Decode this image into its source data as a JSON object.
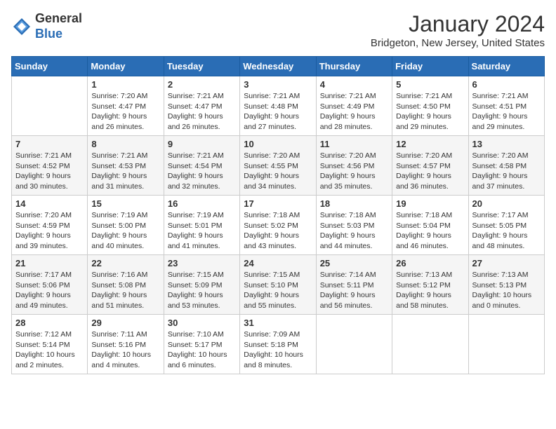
{
  "logo": {
    "general": "General",
    "blue": "Blue"
  },
  "title": "January 2024",
  "subtitle": "Bridgeton, New Jersey, United States",
  "days_of_week": [
    "Sunday",
    "Monday",
    "Tuesday",
    "Wednesday",
    "Thursday",
    "Friday",
    "Saturday"
  ],
  "weeks": [
    [
      {
        "day": "",
        "info": ""
      },
      {
        "day": "1",
        "info": "Sunrise: 7:20 AM\nSunset: 4:47 PM\nDaylight: 9 hours\nand 26 minutes."
      },
      {
        "day": "2",
        "info": "Sunrise: 7:21 AM\nSunset: 4:47 PM\nDaylight: 9 hours\nand 26 minutes."
      },
      {
        "day": "3",
        "info": "Sunrise: 7:21 AM\nSunset: 4:48 PM\nDaylight: 9 hours\nand 27 minutes."
      },
      {
        "day": "4",
        "info": "Sunrise: 7:21 AM\nSunset: 4:49 PM\nDaylight: 9 hours\nand 28 minutes."
      },
      {
        "day": "5",
        "info": "Sunrise: 7:21 AM\nSunset: 4:50 PM\nDaylight: 9 hours\nand 29 minutes."
      },
      {
        "day": "6",
        "info": "Sunrise: 7:21 AM\nSunset: 4:51 PM\nDaylight: 9 hours\nand 29 minutes."
      }
    ],
    [
      {
        "day": "7",
        "info": "Sunrise: 7:21 AM\nSunset: 4:52 PM\nDaylight: 9 hours\nand 30 minutes."
      },
      {
        "day": "8",
        "info": "Sunrise: 7:21 AM\nSunset: 4:53 PM\nDaylight: 9 hours\nand 31 minutes."
      },
      {
        "day": "9",
        "info": "Sunrise: 7:21 AM\nSunset: 4:54 PM\nDaylight: 9 hours\nand 32 minutes."
      },
      {
        "day": "10",
        "info": "Sunrise: 7:20 AM\nSunset: 4:55 PM\nDaylight: 9 hours\nand 34 minutes."
      },
      {
        "day": "11",
        "info": "Sunrise: 7:20 AM\nSunset: 4:56 PM\nDaylight: 9 hours\nand 35 minutes."
      },
      {
        "day": "12",
        "info": "Sunrise: 7:20 AM\nSunset: 4:57 PM\nDaylight: 9 hours\nand 36 minutes."
      },
      {
        "day": "13",
        "info": "Sunrise: 7:20 AM\nSunset: 4:58 PM\nDaylight: 9 hours\nand 37 minutes."
      }
    ],
    [
      {
        "day": "14",
        "info": "Sunrise: 7:20 AM\nSunset: 4:59 PM\nDaylight: 9 hours\nand 39 minutes."
      },
      {
        "day": "15",
        "info": "Sunrise: 7:19 AM\nSunset: 5:00 PM\nDaylight: 9 hours\nand 40 minutes."
      },
      {
        "day": "16",
        "info": "Sunrise: 7:19 AM\nSunset: 5:01 PM\nDaylight: 9 hours\nand 41 minutes."
      },
      {
        "day": "17",
        "info": "Sunrise: 7:18 AM\nSunset: 5:02 PM\nDaylight: 9 hours\nand 43 minutes."
      },
      {
        "day": "18",
        "info": "Sunrise: 7:18 AM\nSunset: 5:03 PM\nDaylight: 9 hours\nand 44 minutes."
      },
      {
        "day": "19",
        "info": "Sunrise: 7:18 AM\nSunset: 5:04 PM\nDaylight: 9 hours\nand 46 minutes."
      },
      {
        "day": "20",
        "info": "Sunrise: 7:17 AM\nSunset: 5:05 PM\nDaylight: 9 hours\nand 48 minutes."
      }
    ],
    [
      {
        "day": "21",
        "info": "Sunrise: 7:17 AM\nSunset: 5:06 PM\nDaylight: 9 hours\nand 49 minutes."
      },
      {
        "day": "22",
        "info": "Sunrise: 7:16 AM\nSunset: 5:08 PM\nDaylight: 9 hours\nand 51 minutes."
      },
      {
        "day": "23",
        "info": "Sunrise: 7:15 AM\nSunset: 5:09 PM\nDaylight: 9 hours\nand 53 minutes."
      },
      {
        "day": "24",
        "info": "Sunrise: 7:15 AM\nSunset: 5:10 PM\nDaylight: 9 hours\nand 55 minutes."
      },
      {
        "day": "25",
        "info": "Sunrise: 7:14 AM\nSunset: 5:11 PM\nDaylight: 9 hours\nand 56 minutes."
      },
      {
        "day": "26",
        "info": "Sunrise: 7:13 AM\nSunset: 5:12 PM\nDaylight: 9 hours\nand 58 minutes."
      },
      {
        "day": "27",
        "info": "Sunrise: 7:13 AM\nSunset: 5:13 PM\nDaylight: 10 hours\nand 0 minutes."
      }
    ],
    [
      {
        "day": "28",
        "info": "Sunrise: 7:12 AM\nSunset: 5:14 PM\nDaylight: 10 hours\nand 2 minutes."
      },
      {
        "day": "29",
        "info": "Sunrise: 7:11 AM\nSunset: 5:16 PM\nDaylight: 10 hours\nand 4 minutes."
      },
      {
        "day": "30",
        "info": "Sunrise: 7:10 AM\nSunset: 5:17 PM\nDaylight: 10 hours\nand 6 minutes."
      },
      {
        "day": "31",
        "info": "Sunrise: 7:09 AM\nSunset: 5:18 PM\nDaylight: 10 hours\nand 8 minutes."
      },
      {
        "day": "",
        "info": ""
      },
      {
        "day": "",
        "info": ""
      },
      {
        "day": "",
        "info": ""
      }
    ]
  ]
}
